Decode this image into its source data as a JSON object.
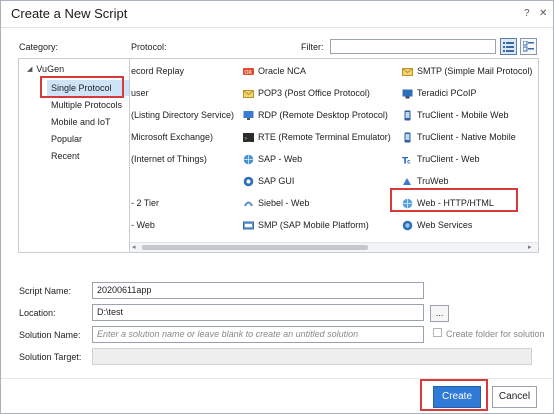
{
  "window": {
    "title": "Create a New Script",
    "help_label": "?",
    "close_label": "✕"
  },
  "labels": {
    "category": "Category:",
    "protocol": "Protocol:",
    "filter": "Filter:",
    "script_name": "Script Name:",
    "location": "Location:",
    "solution_name": "Solution Name:",
    "solution_target": "Solution Target:"
  },
  "filter": {
    "value": "",
    "placeholder": ""
  },
  "categories": {
    "root": "VuGen",
    "items": [
      "Single Protocol",
      "Multiple Protocols",
      "Mobile and IoT",
      "Popular",
      "Recent"
    ],
    "selected": "Single Protocol"
  },
  "protocols": {
    "col1": [
      "ecord Replay",
      "user",
      "(Listing Directory Service)",
      "Microsoft Exchange)",
      "(Internet of Things)",
      "",
      "- 2 Tier",
      "- Web"
    ],
    "col2": [
      "Oracle NCA",
      "POP3 (Post Office Protocol)",
      "RDP (Remote Desktop Protocol)",
      "RTE (Remote Terminal Emulator)",
      "SAP - Web",
      "SAP GUI",
      "Siebel - Web",
      "SMP (SAP Mobile Platform)"
    ],
    "col3": [
      "SMTP (Simple Mail Protocol)",
      "Teradici PCoIP",
      "TruClient - Mobile Web",
      "TruClient - Native Mobile",
      "TruClient - Web",
      "TruWeb",
      "Web - HTTP/HTML",
      "Web Services"
    ],
    "selected": "Web - HTTP/HTML"
  },
  "form": {
    "script_name": "20200611app",
    "location": "D:\\test",
    "browse_label": "...",
    "solution_name_placeholder": "Enter a solution name or leave blank to create an untitled solution",
    "create_folder_label": "Create folder for solution",
    "solution_target": ""
  },
  "buttons": {
    "create": "Create",
    "cancel": "Cancel"
  },
  "colors": {
    "accent": "#2f7ad6",
    "highlight": "#d63a3a",
    "selection": "#cfe3f8"
  }
}
